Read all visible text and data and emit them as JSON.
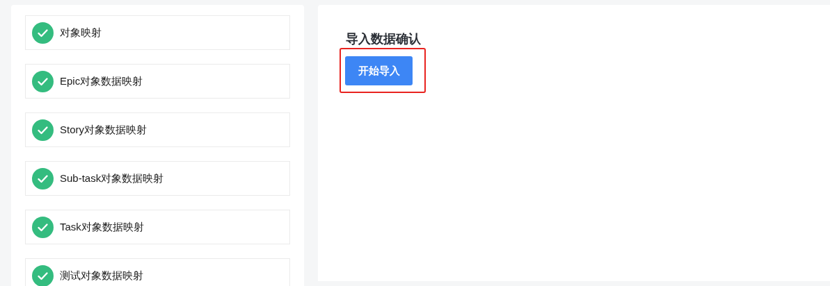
{
  "steps": [
    {
      "label": "对象映射",
      "done": true
    },
    {
      "label": "Epic对象数据映射",
      "done": true
    },
    {
      "label": "Story对象数据映射",
      "done": true
    },
    {
      "label": "Sub-task对象数据映射",
      "done": true
    },
    {
      "label": "Task对象数据映射",
      "done": true
    },
    {
      "label": "测试对象数据映射",
      "done": true
    }
  ],
  "panel": {
    "title": "导入数据确认",
    "button": "开始导入",
    "highlighted": true
  }
}
